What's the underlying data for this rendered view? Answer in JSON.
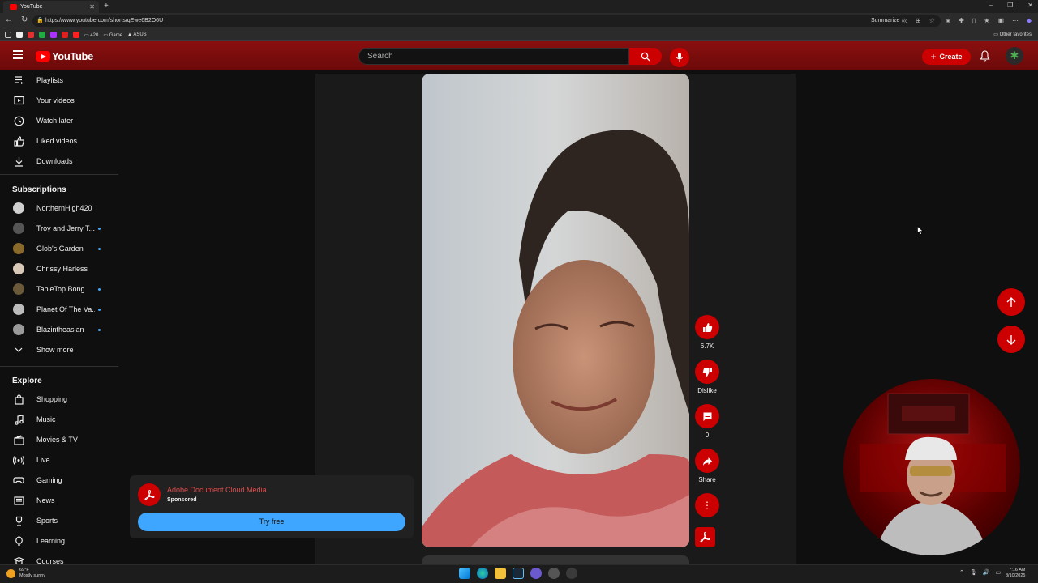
{
  "browser": {
    "tab_title": "YouTube",
    "url": "https://www.youtube.com/shorts/qEwe6B2O6U",
    "summarize": "Summarize",
    "bookmarks": [
      "420",
      "Game",
      "ASUS"
    ],
    "other_favorites": "Other favorites"
  },
  "header": {
    "logo_text": "YouTube",
    "search_placeholder": "Search",
    "create_label": "Create"
  },
  "sidebar": {
    "you_items": [
      {
        "label": "Playlists",
        "icon": "playlist-icon"
      },
      {
        "label": "Your videos",
        "icon": "your-videos-icon"
      },
      {
        "label": "Watch later",
        "icon": "clock-icon"
      },
      {
        "label": "Liked videos",
        "icon": "thumbs-up-icon"
      },
      {
        "label": "Downloads",
        "icon": "download-icon"
      }
    ],
    "subscriptions_heading": "Subscriptions",
    "subscriptions": [
      {
        "label": "NorthernHigh420",
        "dot": false,
        "color": "#cfcfcf"
      },
      {
        "label": "Troy and Jerry T...",
        "dot": true,
        "color": "#555555"
      },
      {
        "label": "Glob's Garden",
        "dot": true,
        "color": "#8a6a2a"
      },
      {
        "label": "Chrissy Harless",
        "dot": false,
        "color": "#d8c8b8"
      },
      {
        "label": "TableTop Bong",
        "dot": true,
        "color": "#6a5a3a"
      },
      {
        "label": "Planet Of The Va...",
        "dot": true,
        "color": "#bbbbbb"
      },
      {
        "label": "Blazintheasian",
        "dot": true,
        "color": "#9a9a9a"
      }
    ],
    "show_more": "Show more",
    "explore_heading": "Explore",
    "explore": [
      {
        "label": "Shopping",
        "icon": "shopping-bag-icon"
      },
      {
        "label": "Music",
        "icon": "music-note-icon"
      },
      {
        "label": "Movies & TV",
        "icon": "clapperboard-icon"
      },
      {
        "label": "Live",
        "icon": "live-icon"
      },
      {
        "label": "Gaming",
        "icon": "gamepad-icon"
      },
      {
        "label": "News",
        "icon": "newspaper-icon"
      },
      {
        "label": "Sports",
        "icon": "trophy-icon"
      },
      {
        "label": "Learning",
        "icon": "lightbulb-icon"
      },
      {
        "label": "Courses",
        "icon": "courses-icon"
      }
    ]
  },
  "shorts": {
    "likes": "6.7K",
    "dislike_label": "Dislike",
    "comments": "0",
    "share_label": "Share"
  },
  "ad": {
    "title": "Adobe Document Cloud Media",
    "sponsored": "Sponsored",
    "cta": "Try free"
  },
  "taskbar": {
    "weather_temp": "69°F",
    "weather_desc": "Mostly sunny",
    "time": "7:16 AM",
    "date": "8/10/2025"
  },
  "colors": {
    "accent": "#cc0000",
    "header_bg": "#7a0d0d",
    "ad_button": "#3ea6ff"
  }
}
